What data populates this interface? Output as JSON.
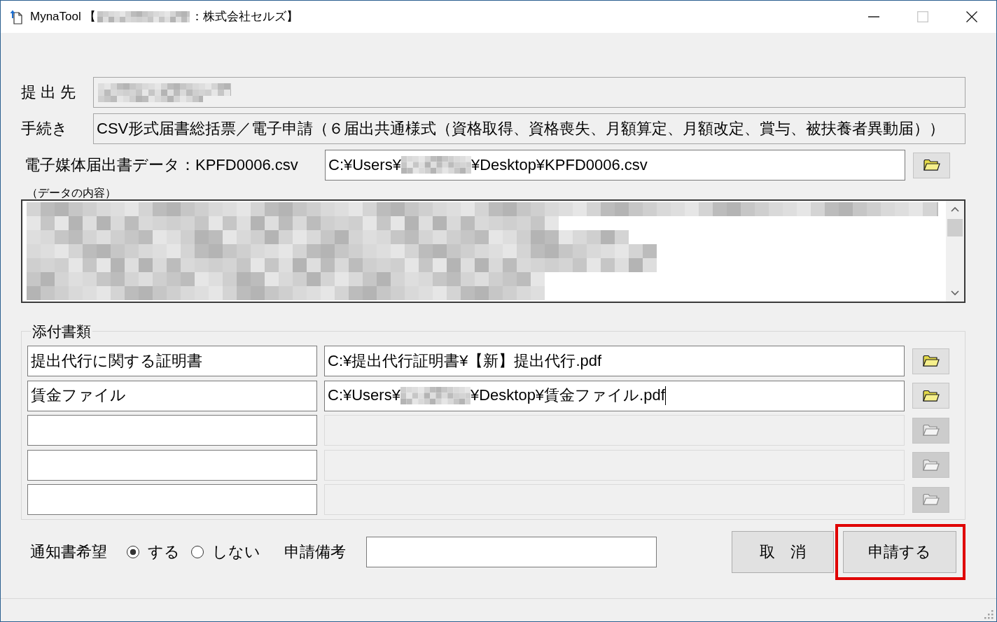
{
  "window": {
    "title": [
      "MynaTool 【",
      "：株式会社セルズ】"
    ],
    "controls": [
      {
        "kind": "minimize",
        "disabled": false
      },
      {
        "kind": "maximize",
        "disabled": true
      },
      {
        "kind": "close",
        "disabled": false
      }
    ]
  },
  "submitter": {
    "label": "提 出 先",
    "readonly": true
  },
  "procedure": {
    "label": "手続き",
    "value": "CSV形式届書総括票／電子申請（６届出共通様式（資格取得、資格喪失、月額算定、月額改定、賞与、被扶養者異動届））",
    "readonly": true
  },
  "data_file": {
    "label": "電子媒体届出書データ：KPFD0006.csv",
    "path": [
      "C:¥Users¥",
      "¥Desktop¥KPFD0006.csv"
    ]
  },
  "data_content": {
    "label": "（データの内容）"
  },
  "attachments": {
    "title": "添付書類",
    "rows": [
      {
        "name": "提出代行に関する証明書",
        "path": [
          "C:¥提出代行証明書¥【新】提出代行.pdf"
        ],
        "disabled": false,
        "focused": false
      },
      {
        "name": "賃金ファイル",
        "path": [
          "C:¥Users¥",
          "¥Desktop¥賃金ファイル.pdf"
        ],
        "disabled": false,
        "focused": true
      },
      {
        "disabled": true,
        "focused": false
      },
      {
        "disabled": true,
        "focused": false
      },
      {
        "disabled": true,
        "focused": false
      }
    ]
  },
  "notification": {
    "label": "通知書希望",
    "options": [
      {
        "label": "する",
        "selected": true
      },
      {
        "label": "しない",
        "selected": false
      }
    ]
  },
  "remarks": {
    "label": "申請備考"
  },
  "buttons": [
    {
      "kind": "cancel",
      "label": "取　消",
      "highlighted": false
    },
    {
      "kind": "submit",
      "label": "申請する",
      "highlighted": true
    }
  ]
}
